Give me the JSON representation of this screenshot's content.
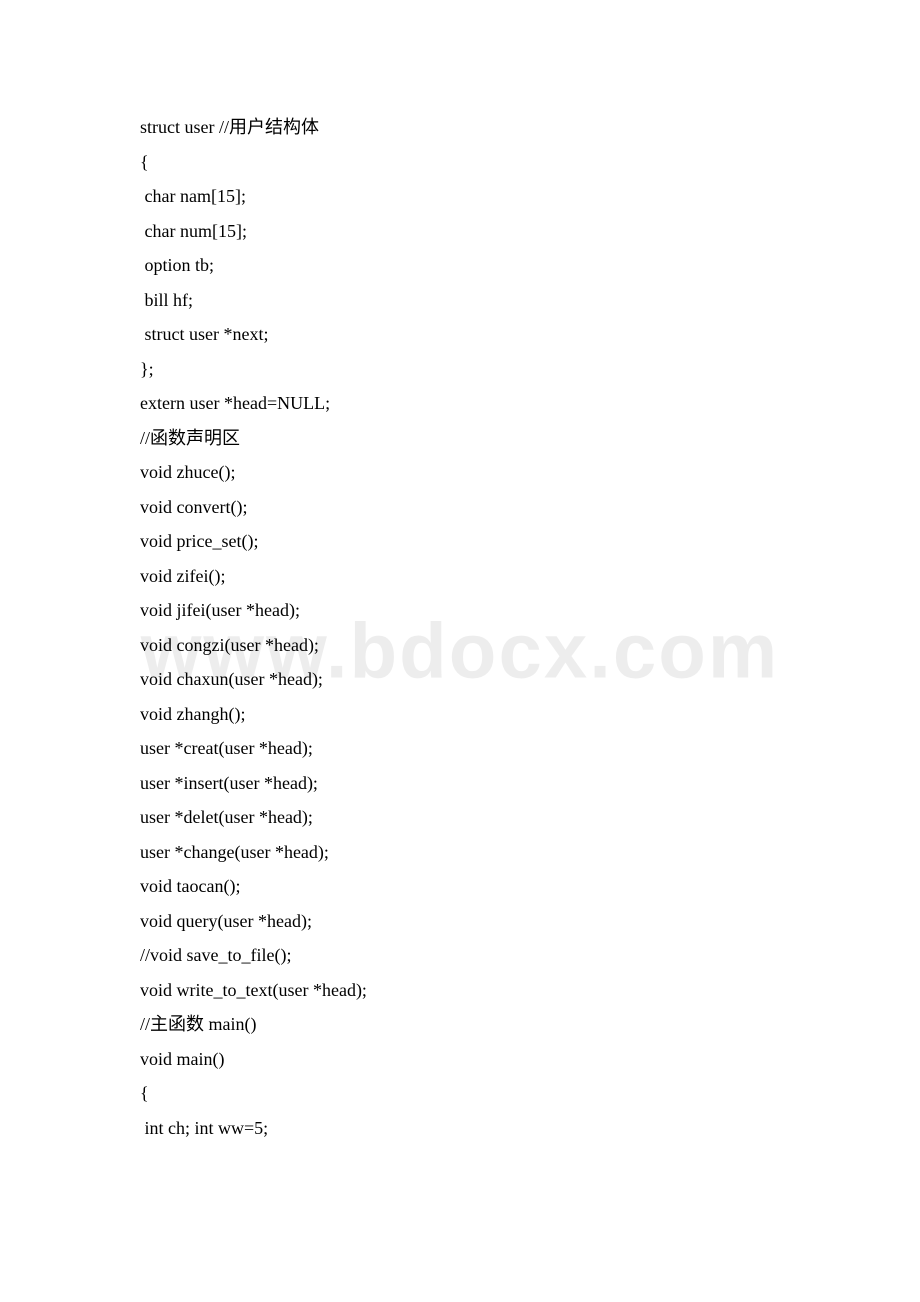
{
  "watermark": "www.bdocx.com",
  "code": {
    "lines": [
      "struct user //用户结构体",
      "{",
      " char nam[15];",
      " char num[15];",
      " option tb;",
      " bill hf;",
      " struct user *next;",
      "};",
      "extern user *head=NULL;",
      "//函数声明区",
      "void zhuce();",
      "void convert();",
      "void price_set();",
      "void zifei();",
      "void jifei(user *head);",
      "void congzi(user *head);",
      "void chaxun(user *head);",
      "void zhangh();",
      "user *creat(user *head);",
      "user *insert(user *head);",
      "user *delet(user *head);",
      "user *change(user *head);",
      "void taocan();",
      "void query(user *head);",
      "//void save_to_file();",
      "void write_to_text(user *head);",
      "//主函数 main()",
      "void main()",
      "{",
      " int ch; int ww=5;"
    ]
  }
}
